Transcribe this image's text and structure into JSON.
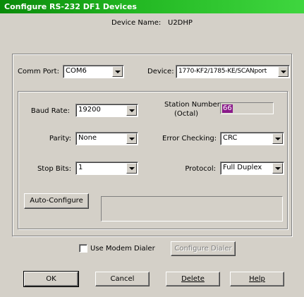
{
  "window": {
    "title": "Configure RS-232 DF1 Devices"
  },
  "device": {
    "label": "Device Name:",
    "value": "U2DHP"
  },
  "comm_port": {
    "label": "Comm Port:",
    "value": "COM6"
  },
  "device_type": {
    "label": "Device:",
    "value": "1770-KF2/1785-KE/SCANport"
  },
  "baud_rate": {
    "label": "Baud Rate:",
    "value": "19200"
  },
  "station_number": {
    "label_line1": "Station Number:",
    "label_line2": "(Octal)",
    "value": "66"
  },
  "parity": {
    "label": "Parity:",
    "value": "None"
  },
  "error_checking": {
    "label": "Error Checking:",
    "value": "CRC"
  },
  "stop_bits": {
    "label": "Stop Bits:",
    "value": "1"
  },
  "protocol": {
    "label": "Protocol:",
    "value": "Full Duplex"
  },
  "auto_configure": {
    "label": "Auto-Configure"
  },
  "modem": {
    "checkbox_label": "Use Modem Dialer",
    "configure_label": "Configure Dialer"
  },
  "buttons": {
    "ok": "OK",
    "cancel": "Cancel",
    "delete": "Delete",
    "help": "Help"
  },
  "colors": {
    "title_bar": "#23b823",
    "dialog_bg": "#d4d0c8",
    "selection": "#8b1b8b"
  }
}
